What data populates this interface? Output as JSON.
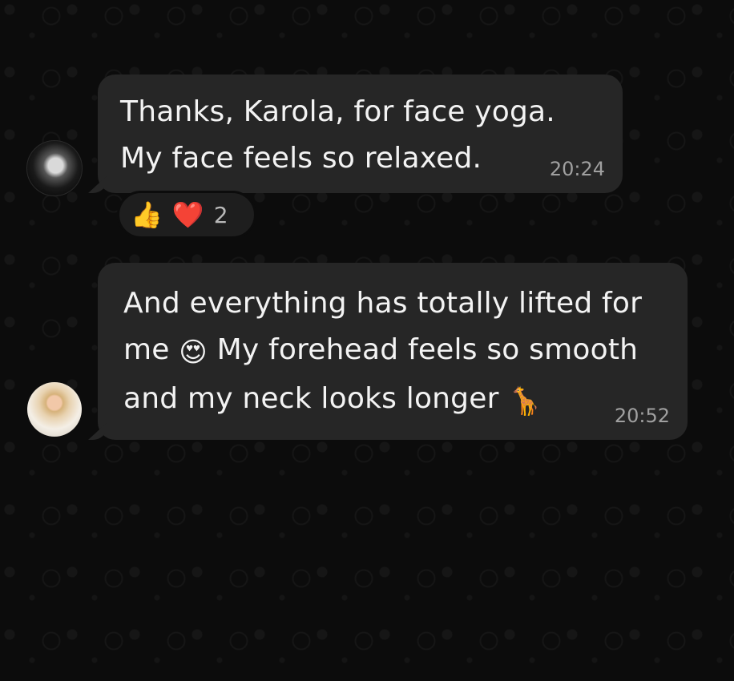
{
  "messages": [
    {
      "line1": "Thanks, Karola, for face yoga.",
      "line2": "My face feels so relaxed.",
      "time": "20:24",
      "reactions": {
        "emoji_1": "👍",
        "emoji_2": "❤️",
        "count": "2"
      },
      "avatar_icon": "profile-photo-1"
    },
    {
      "part1": "And everything has totally lifted for me ",
      "emoji_1": "😍",
      "part2": " My forehead feels so smooth and my neck looks longer ",
      "emoji_2": "🦒",
      "time": "20:52",
      "avatar_icon": "profile-photo-2"
    }
  ],
  "colors": {
    "background": "#0c0c0c",
    "bubble": "#262626",
    "text": "#f3f3f3",
    "timestamp": "#a0a0a0"
  }
}
